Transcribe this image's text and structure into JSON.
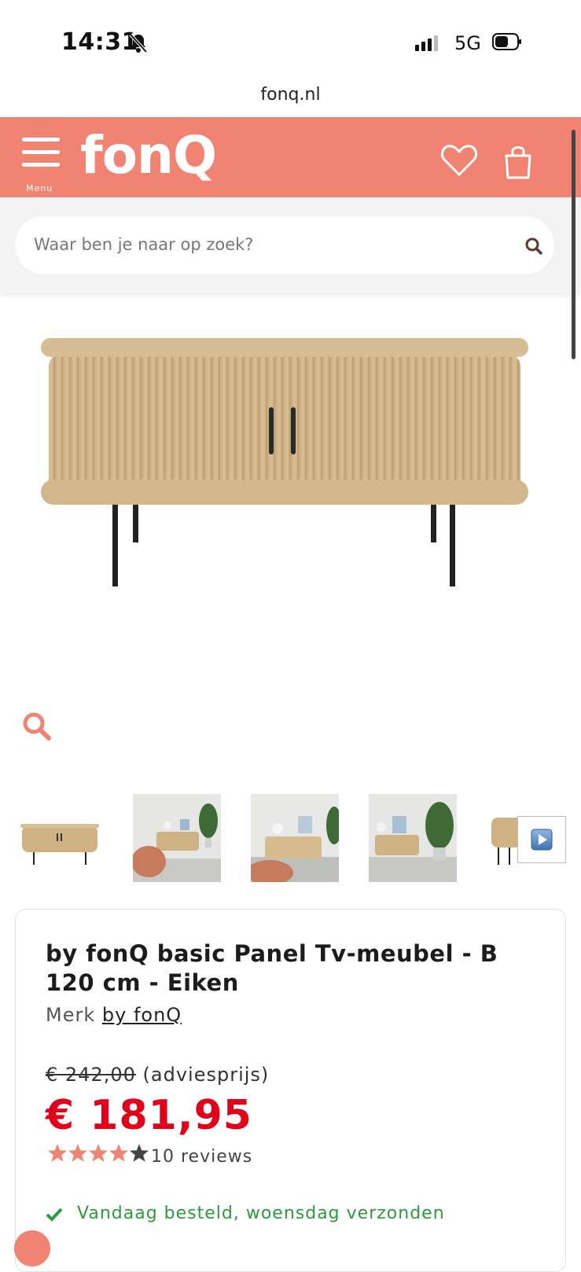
{
  "status_bar": {
    "time": "14:31",
    "network": "5G"
  },
  "browser": {
    "url": "fonq.nl"
  },
  "header": {
    "menu_label": "Menu",
    "logo_text": "fonQ",
    "accent_color": "#f08371"
  },
  "search": {
    "placeholder": "Waar ben je naar op zoek?"
  },
  "product": {
    "title": "by fonQ basic Panel Tv-meubel - B 120 cm - Eiken",
    "brand_prefix": "Merk",
    "brand_link": "by fonQ",
    "old_price": "€ 242,00",
    "old_price_note": "(adviesprijs)",
    "price": "€ 181,95",
    "price_color": "#e0001a",
    "rating": 4,
    "rating_max": 5,
    "reviews_label": "10 reviews",
    "shipping": "Vandaag besteld, woensdag verzonden"
  },
  "thumbnails": [
    {
      "name": "thumbnail-product-front"
    },
    {
      "name": "thumbnail-room-1"
    },
    {
      "name": "thumbnail-room-2"
    },
    {
      "name": "thumbnail-room-3"
    },
    {
      "name": "thumbnail-product-side"
    }
  ]
}
